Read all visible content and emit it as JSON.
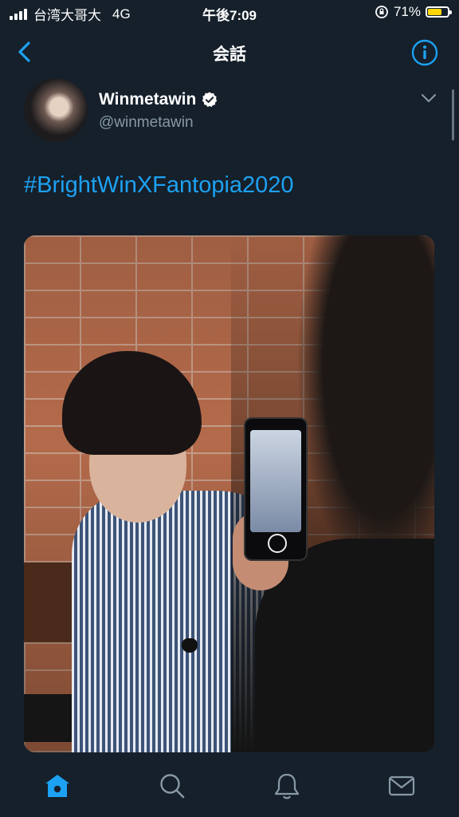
{
  "status_bar": {
    "carrier": "台湾大哥大",
    "network": "4G",
    "time": "午後7:09",
    "battery": "71%",
    "battery_level": 0.71,
    "battery_color": "#ffd60a"
  },
  "nav": {
    "title": "会話",
    "back_icon": "chevron-left-icon",
    "info_icon": "info-icon"
  },
  "tweet": {
    "display_name": "Winmetawin",
    "handle": "@winmetawin",
    "verified": true,
    "text": "#BrightWinXFantopia2020",
    "media": "photo"
  },
  "colors": {
    "background": "#15202b",
    "accent": "#1da1f2",
    "muted": "#8899a6"
  },
  "tab_bar": {
    "items": [
      "home-icon",
      "search-icon",
      "bell-icon",
      "mail-icon"
    ],
    "active": "home-icon"
  }
}
